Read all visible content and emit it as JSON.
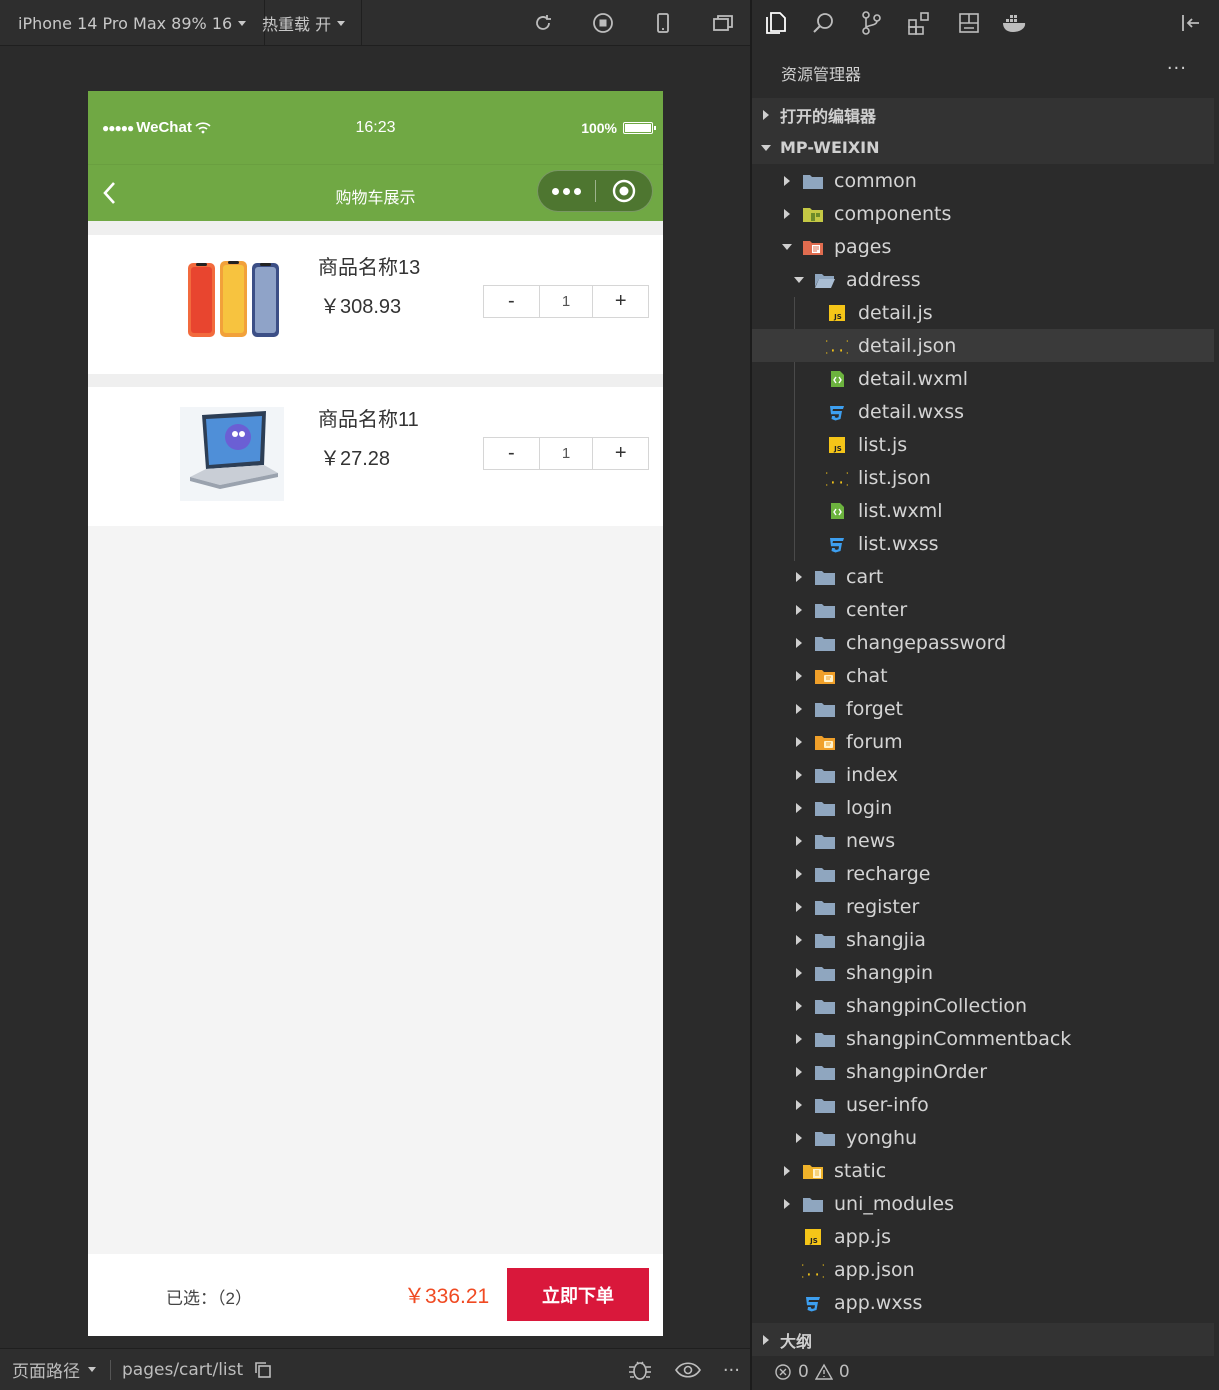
{
  "sim_toolbar": {
    "device": "iPhone 14 Pro Max 89% 16",
    "reload": "热重载 开",
    "icons": [
      "refresh-icon",
      "stop-icon",
      "phone-icon",
      "window-icon"
    ]
  },
  "phone": {
    "status": {
      "carrier": "WeChat",
      "time": "16:23",
      "battery": "100%"
    },
    "nav": {
      "title": "购物车展示"
    },
    "items": [
      {
        "name": "商品名称13",
        "price": "￥308.93",
        "qty": "1",
        "minus": "-",
        "plus": "+"
      },
      {
        "name": "商品名称11",
        "price": "￥27.28",
        "qty": "1",
        "minus": "-",
        "plus": "+"
      }
    ],
    "bottom": {
      "selected": "已选：（2）",
      "total": "￥336.21",
      "order": "立即下单"
    }
  },
  "sim_footer": {
    "label": "页面路径",
    "path": "pages/cart/list"
  },
  "explorer": {
    "title": "资源管理器",
    "more": "···",
    "sections": {
      "open_editors": "打开的编辑器",
      "project": "MP-WEIXIN",
      "outline": "大纲"
    },
    "tree": [
      {
        "label": "common",
        "kind": "folder",
        "depth": 0,
        "state": "closed"
      },
      {
        "label": "components",
        "kind": "folder-components",
        "depth": 0,
        "state": "closed"
      },
      {
        "label": "pages",
        "kind": "folder-pages",
        "depth": 0,
        "state": "open"
      },
      {
        "label": "address",
        "kind": "folder",
        "depth": 1,
        "state": "open"
      },
      {
        "label": "detail.js",
        "kind": "js",
        "depth": 2
      },
      {
        "label": "detail.json",
        "kind": "json",
        "depth": 2,
        "selected": true
      },
      {
        "label": "detail.wxml",
        "kind": "wxml",
        "depth": 2
      },
      {
        "label": "detail.wxss",
        "kind": "wxss",
        "depth": 2
      },
      {
        "label": "list.js",
        "kind": "js",
        "depth": 2
      },
      {
        "label": "list.json",
        "kind": "json",
        "depth": 2
      },
      {
        "label": "list.wxml",
        "kind": "wxml",
        "depth": 2
      },
      {
        "label": "list.wxss",
        "kind": "wxss",
        "depth": 2
      },
      {
        "label": "cart",
        "kind": "folder",
        "depth": 1,
        "state": "closed"
      },
      {
        "label": "center",
        "kind": "folder",
        "depth": 1,
        "state": "closed"
      },
      {
        "label": "changepassword",
        "kind": "folder",
        "depth": 1,
        "state": "closed"
      },
      {
        "label": "chat",
        "kind": "folder-chat",
        "depth": 1,
        "state": "closed"
      },
      {
        "label": "forget",
        "kind": "folder",
        "depth": 1,
        "state": "closed"
      },
      {
        "label": "forum",
        "kind": "folder-chat",
        "depth": 1,
        "state": "closed"
      },
      {
        "label": "index",
        "kind": "folder",
        "depth": 1,
        "state": "closed"
      },
      {
        "label": "login",
        "kind": "folder",
        "depth": 1,
        "state": "closed"
      },
      {
        "label": "news",
        "kind": "folder",
        "depth": 1,
        "state": "closed"
      },
      {
        "label": "recharge",
        "kind": "folder",
        "depth": 1,
        "state": "closed"
      },
      {
        "label": "register",
        "kind": "folder",
        "depth": 1,
        "state": "closed"
      },
      {
        "label": "shangjia",
        "kind": "folder",
        "depth": 1,
        "state": "closed"
      },
      {
        "label": "shangpin",
        "kind": "folder",
        "depth": 1,
        "state": "closed"
      },
      {
        "label": "shangpinCollection",
        "kind": "folder",
        "depth": 1,
        "state": "closed"
      },
      {
        "label": "shangpinCommentback",
        "kind": "folder",
        "depth": 1,
        "state": "closed"
      },
      {
        "label": "shangpinOrder",
        "kind": "folder",
        "depth": 1,
        "state": "closed"
      },
      {
        "label": "user-info",
        "kind": "folder",
        "depth": 1,
        "state": "closed"
      },
      {
        "label": "yonghu",
        "kind": "folder",
        "depth": 1,
        "state": "closed"
      },
      {
        "label": "static",
        "kind": "folder-static",
        "depth": 0,
        "state": "closed"
      },
      {
        "label": "uni_modules",
        "kind": "folder",
        "depth": 0,
        "state": "closed"
      },
      {
        "label": "app.js",
        "kind": "js",
        "depth": 0
      },
      {
        "label": "app.json",
        "kind": "json",
        "depth": 0
      },
      {
        "label": "app.wxss",
        "kind": "wxss",
        "depth": 0
      }
    ],
    "problems": {
      "errors": "0",
      "warnings": "0"
    }
  },
  "colors": {
    "wechat_green": "#70a844",
    "order_red": "#d9183b",
    "price_orange": "#f04a22",
    "folder_blue": "#8fa6bf",
    "js_yellow": "#f5c518",
    "wxss_blue": "#3d9ff0",
    "wxml_green": "#6cb33e"
  }
}
